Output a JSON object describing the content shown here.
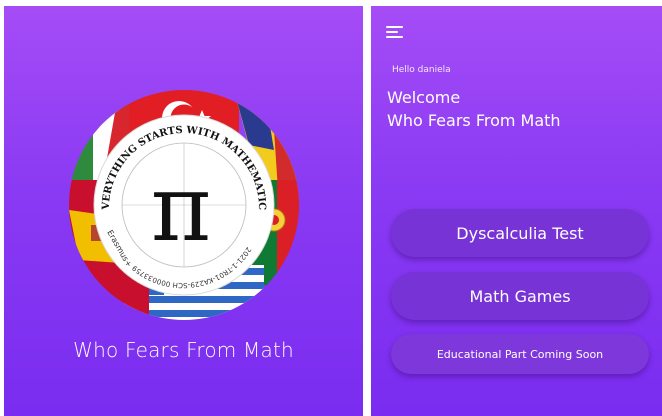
{
  "splash": {
    "title": "Who Fears From Math",
    "logo": {
      "ring_text_top": "EVERYTHING STARTS WITH MATHEMATICS",
      "ring_text_bottom": "2021-1-TR01-KA229-SCH 000033759",
      "ring_text_left": "Erasmus+",
      "symbol": "π"
    }
  },
  "home": {
    "greeting": "Hello daniela",
    "welcome_line1": "Welcome",
    "welcome_line2": "Who Fears From Math",
    "buttons": {
      "dyscalculia": "Dyscalculia Test",
      "games": "Math Games",
      "educational": "Educational Part Coming Soon"
    },
    "menu_icon": "hamburger-menu-icon"
  },
  "colors": {
    "background_top": "#a54cf6",
    "background_bottom": "#7a2cf0",
    "button": "#7733d6",
    "text": "#ffffff"
  }
}
